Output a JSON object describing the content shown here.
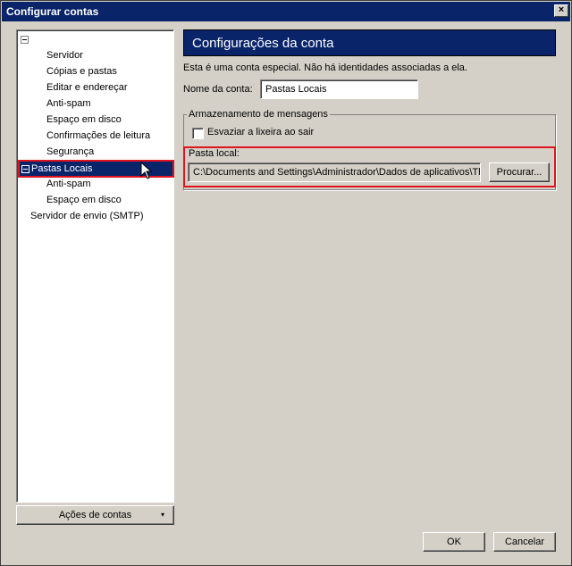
{
  "window": {
    "title": "Configurar contas",
    "close_glyph": "×"
  },
  "tree": {
    "items": [
      {
        "label": "Servidor"
      },
      {
        "label": "Cópias e pastas"
      },
      {
        "label": "Editar e endereçar"
      },
      {
        "label": "Anti-spam"
      },
      {
        "label": "Espaço em disco"
      },
      {
        "label": "Confirmações de leitura"
      },
      {
        "label": "Segurança"
      }
    ],
    "selected_label": "Pastas Locais",
    "selected_children": [
      {
        "label": "Anti-spam"
      },
      {
        "label": "Espaço em disco"
      }
    ],
    "smtp_label": "Servidor de envio (SMTP)"
  },
  "actions_button": {
    "label": "Ações de contas",
    "arrow": "▾"
  },
  "main": {
    "header": "Configurações da conta",
    "info": "Esta é uma conta especial. Não há identidades associadas a ela.",
    "name_label": "Nome da conta:",
    "name_value": "Pastas Locais",
    "storage_legend": "Armazenamento de mensagens",
    "empty_trash_label": "Esvaziar a lixeira ao sair",
    "empty_trash_checked": false,
    "local_folder_label": "Pasta local:",
    "local_folder_value": "C:\\Documents and Settings\\Administrador\\Dados de aplicativos\\Th",
    "browse_label": "Procurar..."
  },
  "footer": {
    "ok_label": "OK",
    "cancel_label": "Cancelar"
  },
  "colors": {
    "selection": "#0a246a",
    "highlight_border": "#e0141e",
    "face": "#d4d0c8"
  }
}
